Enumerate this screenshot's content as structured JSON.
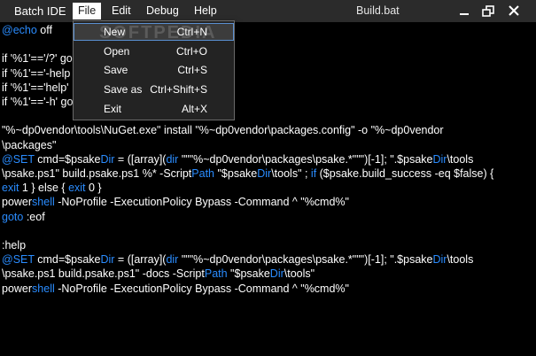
{
  "titlebar": {
    "app_title": "Batch IDE",
    "menus": [
      "File",
      "Edit",
      "Debug",
      "Help"
    ],
    "doc_title": "Build.bat"
  },
  "colors": {
    "keyword": "#2a8cff",
    "background": "#000000",
    "titlebar": "#2b2b2b"
  },
  "editor": {
    "lines": [
      [
        {
          "t": "@echo",
          "c": "kw"
        },
        {
          "t": " off",
          "c": ""
        }
      ],
      [],
      [
        {
          "t": "if '%1'=='/?' go",
          "c": ""
        }
      ],
      [
        {
          "t": "if '%1'=='-help",
          "c": ""
        }
      ],
      [
        {
          "t": "if '%1'=='help'",
          "c": ""
        }
      ],
      [
        {
          "t": "if '%1'=='-h' go",
          "c": ""
        }
      ],
      [],
      [
        {
          "t": "\"%~dp0vendor\\tools\\NuGet.exe\" install \"%~dp0vendor\\packages.config\" -o \"%~dp0vendor",
          "c": ""
        }
      ],
      [
        {
          "t": "\\packages\"",
          "c": ""
        }
      ],
      [
        {
          "t": "@SET",
          "c": "kw"
        },
        {
          "t": " cmd=$psake",
          "c": ""
        },
        {
          "t": "Dir",
          "c": "kw"
        },
        {
          "t": " = ([array](",
          "c": ""
        },
        {
          "t": "dir",
          "c": "kw"
        },
        {
          "t": " \"\"\"%~dp0vendor\\packages\\psake.*\"\"\")[-1]; \".$psake",
          "c": ""
        },
        {
          "t": "Dir",
          "c": "kw"
        },
        {
          "t": "\\tools",
          "c": ""
        }
      ],
      [
        {
          "t": "\\psake.ps1\" build.psake.ps1 %* -Script",
          "c": ""
        },
        {
          "t": "Path",
          "c": "kw"
        },
        {
          "t": " \"$psake",
          "c": ""
        },
        {
          "t": "Dir",
          "c": "kw"
        },
        {
          "t": "\\tools\" ; ",
          "c": ""
        },
        {
          "t": "if",
          "c": "kw"
        },
        {
          "t": " ($psake.build_success -eq $false) {",
          "c": ""
        }
      ],
      [
        {
          "t": "exit",
          "c": "kw"
        },
        {
          "t": " 1 } else { ",
          "c": ""
        },
        {
          "t": "exit",
          "c": "kw"
        },
        {
          "t": " 0 }",
          "c": ""
        }
      ],
      [
        {
          "t": "power",
          "c": ""
        },
        {
          "t": "shell",
          "c": "kw"
        },
        {
          "t": " -NoProfile -ExecutionPolicy Bypass -Command ^ \"%cmd%\"",
          "c": ""
        }
      ],
      [
        {
          "t": "goto",
          "c": "kw"
        },
        {
          "t": " :eof",
          "c": ""
        }
      ],
      [],
      [
        {
          "t": ":help",
          "c": ""
        }
      ],
      [
        {
          "t": "@SET",
          "c": "kw"
        },
        {
          "t": " cmd=$psake",
          "c": ""
        },
        {
          "t": "Dir",
          "c": "kw"
        },
        {
          "t": " = ([array](",
          "c": ""
        },
        {
          "t": "dir",
          "c": "kw"
        },
        {
          "t": " \"\"\"%~dp0vendor\\packages\\psake.*\"\"\")[-1]; \".$psake",
          "c": ""
        },
        {
          "t": "Dir",
          "c": "kw"
        },
        {
          "t": "\\tools",
          "c": ""
        }
      ],
      [
        {
          "t": "\\psake.ps1 build.psake.ps1\" -docs -Script",
          "c": ""
        },
        {
          "t": "Path",
          "c": "kw"
        },
        {
          "t": " \"$psake",
          "c": ""
        },
        {
          "t": "Dir",
          "c": "kw"
        },
        {
          "t": "\\tools\"",
          "c": ""
        }
      ],
      [
        {
          "t": "power",
          "c": ""
        },
        {
          "t": "shell",
          "c": "kw"
        },
        {
          "t": " -NoProfile -ExecutionPolicy Bypass -Command ^ \"%cmd%\"",
          "c": ""
        }
      ]
    ]
  },
  "file_menu": {
    "items": [
      {
        "label": "New",
        "shortcut": "Ctrl+N"
      },
      {
        "label": "Open",
        "shortcut": "Ctrl+O"
      },
      {
        "label": "Save",
        "shortcut": "Ctrl+S"
      },
      {
        "label": "Save as",
        "shortcut": "Ctrl+Shift+S"
      },
      {
        "label": "Exit",
        "shortcut": "Alt+X"
      }
    ]
  },
  "watermark": "SOFTPEDIA"
}
